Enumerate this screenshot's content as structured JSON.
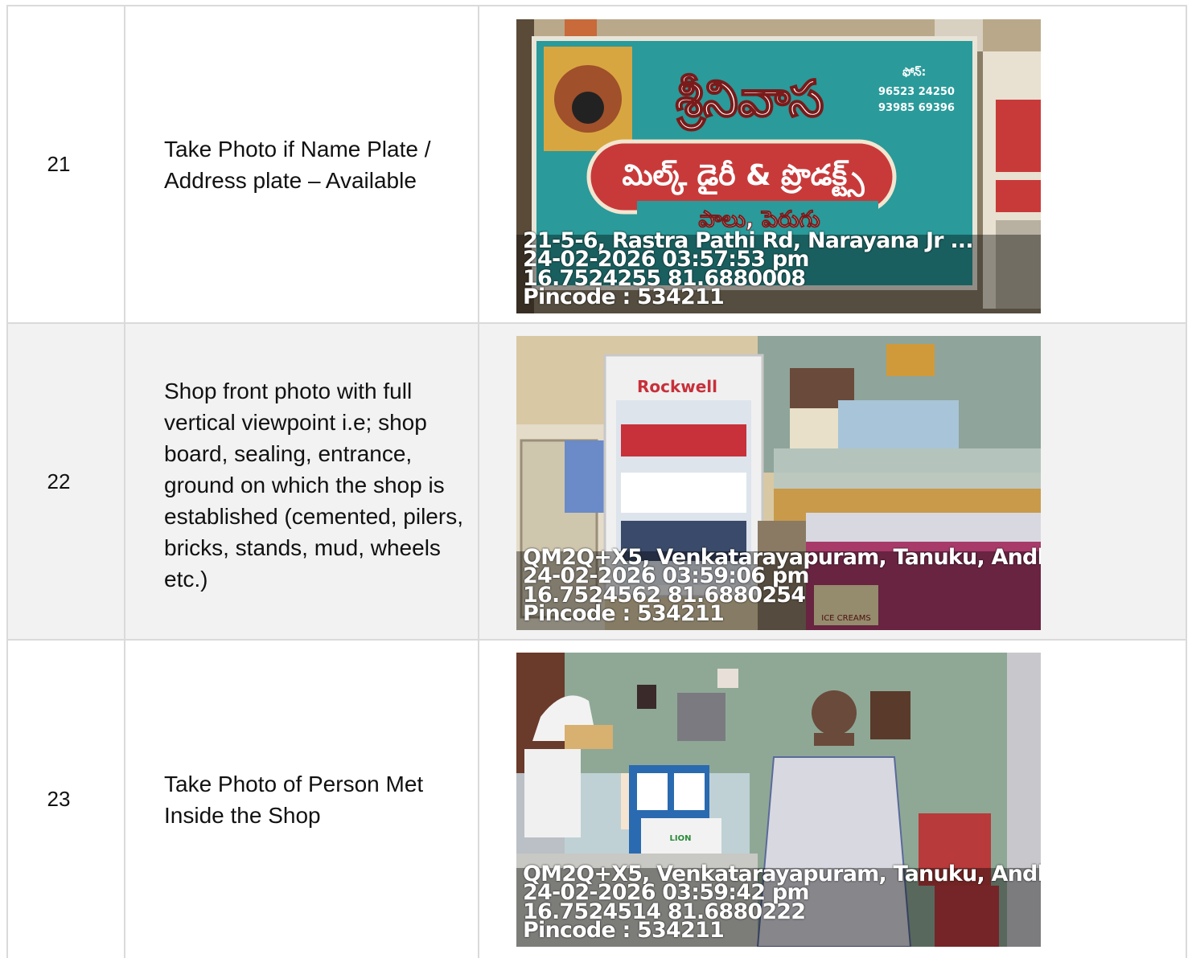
{
  "rows": [
    {
      "number": "21",
      "description": "Take Photo if Name Plate / Address plate – Available",
      "photo": {
        "subject": "shop-name-board",
        "sign_title": "శ్రీనివాస",
        "sign_subtitle": "మిల్క్ డైరీ & ప్రొడక్ట్స్",
        "sign_products": "పాలు, పెరుగు",
        "sign_phone_label": "ఫోన్:",
        "sign_phone_1": "96523 24250",
        "sign_phone_2": "93985 69396",
        "address": "21-5-6, Rastra Pathi Rd, Narayana Jr ...",
        "timestamp": "24-02-2026 03:57:53 pm",
        "coordinates": "16.7524255 81.6880008",
        "pincode": "Pincode : 534211"
      }
    },
    {
      "number": "22",
      "description": "Shop front photo with full vertical viewpoint i.e; shop board, sealing, entrance, ground on which the shop is established (cemented, pilers, bricks, stands, mud, wheels etc.)",
      "photo": {
        "subject": "shop-front-interior",
        "fridge_brand": "Rockwell",
        "freezer_label": "ICE CREAMS",
        "address": "QM2Q+X5, Venkatarayapuram, Tanuku, Andh",
        "timestamp": "24-02-2026 03:59:06 pm",
        "coordinates": "16.7524562 81.6880254",
        "pincode": "Pincode : 534211"
      }
    },
    {
      "number": "23",
      "description": "Take Photo of Person Met Inside the Shop",
      "photo": {
        "subject": "person-in-shop",
        "box_label": "LION",
        "address": "QM2Q+X5, Venkatarayapuram, Tanuku, Andh",
        "timestamp": "24-02-2026 03:59:42 pm",
        "coordinates": "16.7524514 81.6880222",
        "pincode": "Pincode : 534211"
      }
    }
  ]
}
